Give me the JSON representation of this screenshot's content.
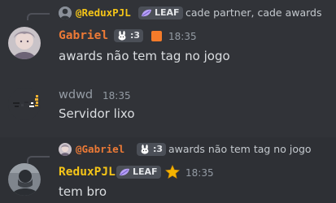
{
  "colors": {
    "background": "#313338",
    "hover_background": "#2e3035",
    "gabriel_name": "#ec7a36",
    "reduxpjl_name": "#f5c518",
    "wdwd_name": "#949ba4",
    "timestamp": "#949ba4",
    "message_text": "#dbdee1",
    "tag_bg": "#4b4f57"
  },
  "messages": [
    {
      "reply": {
        "author": "@ReduxPJL",
        "tag": "LEAF",
        "tag_icon": "leaf-icon",
        "text": "cade partner, cade awards"
      },
      "author": "Gabriel",
      "tag": ":3",
      "tag_icon": "bunny-icon",
      "badge_icon": "orange-square-badge-icon",
      "timestamp": "18:35",
      "content": "awards não tem tag no jogo"
    },
    {
      "author": "wdwd",
      "timestamp": "18:35",
      "content": "Servidor lixo"
    },
    {
      "reply": {
        "author": "@Gabriel",
        "tag": ":3",
        "tag_icon": "bunny-icon",
        "text": "awards não tem tag no jogo"
      },
      "author": "ReduxPJL",
      "tag": "LEAF",
      "tag_icon": "leaf-icon",
      "badge_icon": "star-badge-icon",
      "timestamp": "18:35",
      "content": "tem bro"
    }
  ]
}
